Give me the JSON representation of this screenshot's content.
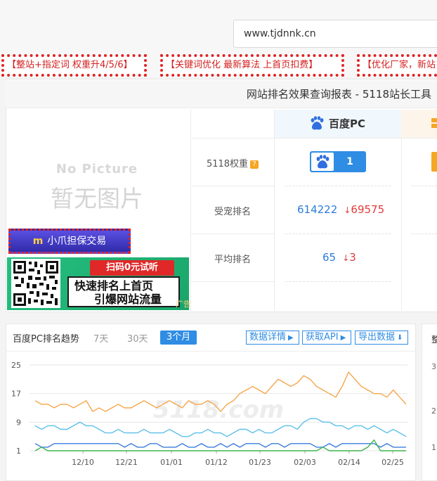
{
  "header": {
    "url_value": "www.tjdnnk.cn"
  },
  "ads": [
    "【整站+指定词 权重升4/5/6】",
    "【关键词优化 最新算法 上首页扣费】",
    "【优化厂家，新站"
  ],
  "report": {
    "title": "网站排名效果查询报表 - 5118站长工具",
    "no_picture_en": "No Picture",
    "no_picture_cn": "暂无图片",
    "escrow_label": "小爪担保交易",
    "promo": {
      "button": "扫码0元试听",
      "line1": "快速排名上首页",
      "line2": "引爆网站流量",
      "ad_tag": "广告"
    },
    "engine": "百度PC",
    "rows": [
      {
        "label": "5118权重",
        "help": "?",
        "value": "1"
      },
      {
        "label": "受宠排名",
        "value": "614222",
        "delta": "69575",
        "delta_dir": "down"
      },
      {
        "label": "平均排名",
        "value": "65",
        "delta": "3",
        "delta_dir": "down"
      }
    ]
  },
  "trend": {
    "title": "百度PC排名趋势",
    "tabs": [
      "7天",
      "30天",
      "3个月"
    ],
    "active_tab": "3个月",
    "buttons": [
      "数据详情",
      "获取API",
      "导出数据"
    ],
    "colors": {
      "orange": "#f5a64b",
      "cyan": "#5bc0ea",
      "blue": "#3b7de0",
      "green": "#3fb54f"
    }
  },
  "chart_data": {
    "type": "line",
    "y_ticks": [
      "25",
      "17",
      "9",
      "1"
    ],
    "x_ticks": [
      "12/10",
      "12/21",
      "01/01",
      "01/12",
      "01/23",
      "02/03",
      "02/14",
      "02/25"
    ],
    "ylim": [
      1,
      25
    ],
    "watermark": "5118.com",
    "series": [
      {
        "color": "#f5a64b",
        "values": [
          15,
          14,
          14,
          13,
          14,
          14,
          13,
          14,
          15,
          12,
          13,
          12,
          13,
          14,
          13,
          13,
          14,
          15,
          14,
          13,
          14,
          15,
          14,
          13,
          15,
          14,
          14,
          15,
          14,
          12,
          14,
          15,
          17,
          18,
          19,
          18,
          17,
          19,
          21,
          20,
          19,
          20,
          22,
          21,
          19,
          18,
          17,
          16,
          19,
          23,
          21,
          19,
          18,
          17,
          17,
          16,
          18,
          16,
          14
        ]
      },
      {
        "color": "#5bc0ea",
        "values": [
          8,
          7,
          8,
          8,
          7,
          7,
          8,
          9,
          8,
          8,
          7,
          6,
          6,
          7,
          6,
          6,
          6,
          7,
          6,
          6,
          6,
          7,
          6,
          5,
          5,
          6,
          6,
          7,
          6,
          6,
          5,
          6,
          7,
          7,
          6,
          7,
          6,
          6,
          7,
          8,
          8,
          7,
          9,
          10,
          10,
          9,
          9,
          8,
          8,
          7,
          8,
          8,
          7,
          8,
          7,
          6,
          7,
          6,
          5
        ]
      },
      {
        "color": "#3b7de0",
        "values": [
          3,
          2,
          2,
          3,
          3,
          3,
          3,
          3,
          3,
          3,
          3,
          3,
          3,
          3,
          2,
          3,
          2,
          2,
          3,
          3,
          2,
          2,
          2,
          3,
          2,
          2,
          3,
          2,
          2,
          3,
          2,
          3,
          2,
          3,
          3,
          3,
          2,
          3,
          3,
          2,
          3,
          3,
          3,
          3,
          2,
          2,
          3,
          2,
          3,
          3,
          3,
          3,
          3,
          3,
          2,
          3,
          2,
          2,
          2
        ]
      },
      {
        "color": "#3fb54f",
        "values": [
          1,
          2,
          1,
          1,
          1,
          1,
          1,
          1,
          1,
          1,
          1,
          1,
          1,
          1,
          1,
          1,
          1,
          1,
          1,
          1,
          1,
          1,
          1,
          1,
          1,
          1,
          1,
          1,
          1,
          1,
          1,
          1,
          1,
          1,
          1,
          1,
          1,
          1,
          1,
          1,
          1,
          1,
          1,
          1,
          1,
          2,
          1,
          1,
          1,
          1,
          1,
          1,
          2,
          4,
          1,
          1,
          1,
          1,
          1
        ]
      }
    ]
  }
}
